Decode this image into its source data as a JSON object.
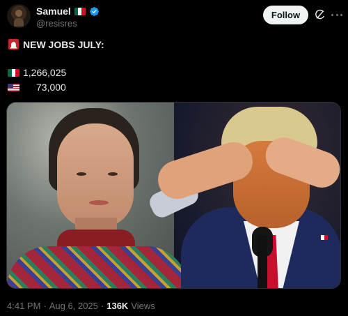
{
  "author": {
    "display_name": "Samuel",
    "handle": "@resisres",
    "verified": true,
    "name_flag": "mexico-flag"
  },
  "actions": {
    "follow_label": "Follow",
    "grok_icon": "grok-icon",
    "more_icon": "more-icon"
  },
  "post": {
    "headline_icon": "siren-icon",
    "headline": "NEW JOBS JULY:",
    "stats": [
      {
        "flag": "mexico-flag",
        "value": "1,266,025"
      },
      {
        "flag": "usa-flag",
        "value": "73,000"
      }
    ]
  },
  "meta": {
    "time": "4:41 PM",
    "sep1": "·",
    "date": "Aug 6, 2025",
    "sep2": "·",
    "views_count": "136K",
    "views_label": "Views"
  },
  "colors": {
    "background": "#000000",
    "text_primary": "#e7e9ea",
    "text_secondary": "#71767b",
    "verified_blue": "#1d9bf0",
    "follow_bg": "#eff3f4"
  }
}
